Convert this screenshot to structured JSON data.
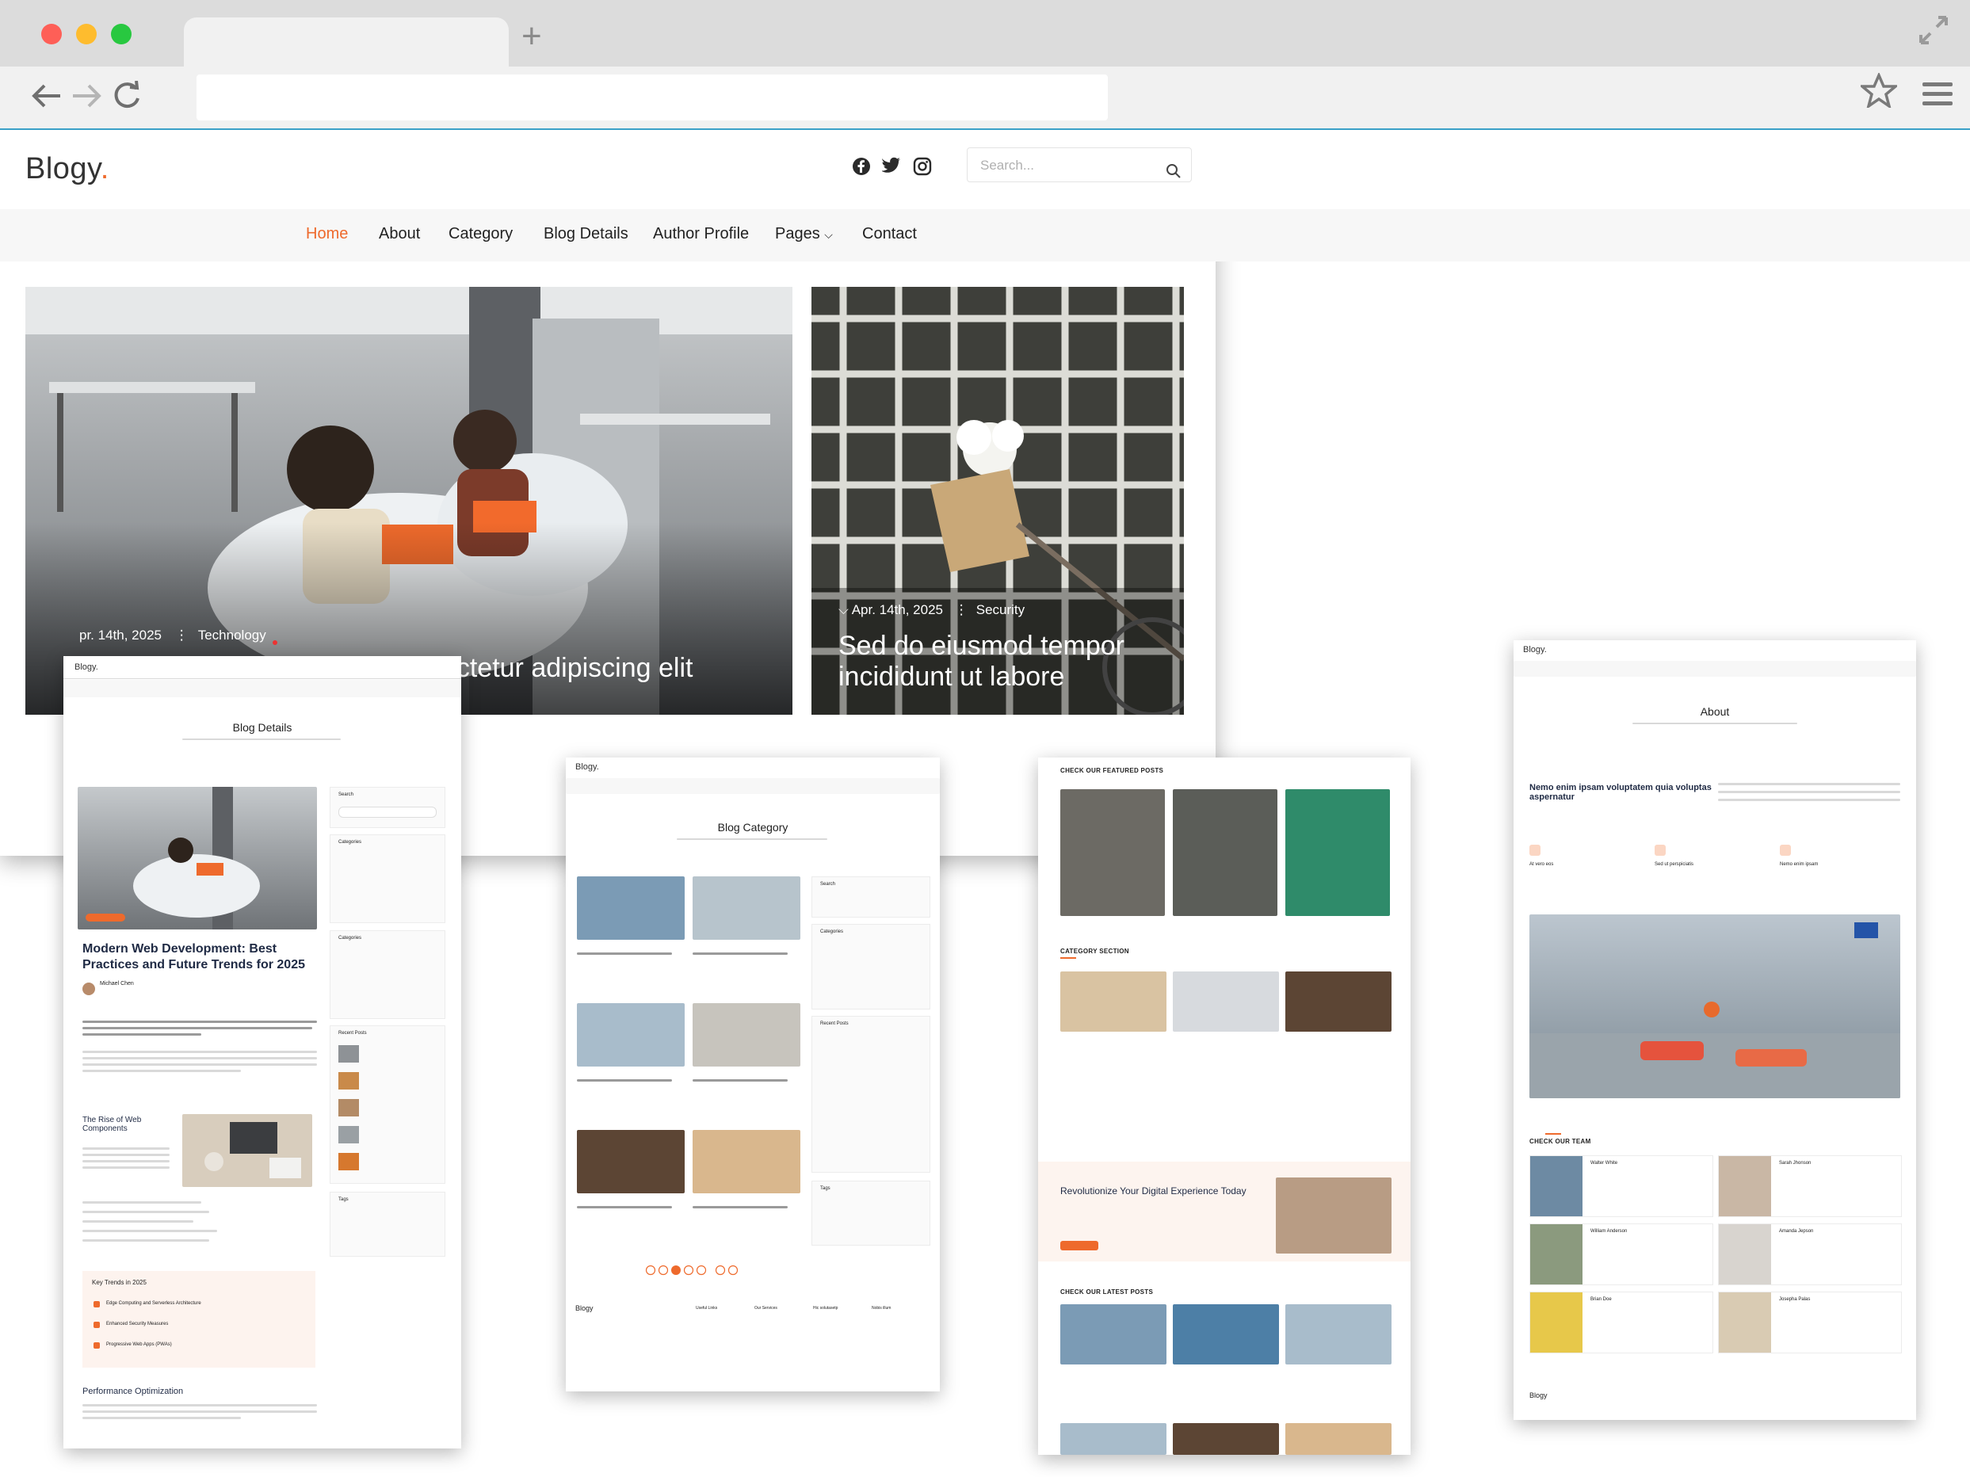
{
  "colors": {
    "accent": "#ee6a2c",
    "traffic_red": "#fe5f57",
    "traffic_yellow": "#febc2e",
    "traffic_green": "#28c840"
  },
  "browser": {
    "new_tab": "+"
  },
  "site": {
    "logo": "Blogy",
    "logo_dot": ".",
    "social_icons": [
      "facebook-icon",
      "twitter-icon",
      "instagram-icon"
    ],
    "search_placeholder": "Search...",
    "nav": [
      {
        "label": "Home",
        "active": true
      },
      {
        "label": "About"
      },
      {
        "label": "Category"
      },
      {
        "label": "Blog Details"
      },
      {
        "label": "Author Profile"
      },
      {
        "label": "Pages"
      },
      {
        "label": "Contact"
      }
    ],
    "pages_caret": "⌵"
  },
  "hero": {
    "main": {
      "date": "pr. 14th, 2025",
      "category": "Technology",
      "title": "rem ipsum dolor sit amet, consectetur adipiscing elit"
    },
    "side": {
      "date": "Apr. 14th, 2025",
      "category": "Security",
      "title": "Sed do eiusmod tempor incididunt ut labore"
    }
  },
  "blog_details": {
    "logo": "Blogy.",
    "title": "Blog Details",
    "post_title": "Modern Web Development: Best Practices and Future Trends for 2025",
    "author": "Michael Chen",
    "sub_heading": "The Rise of Web Components",
    "key_trends": "Key Trends in 2025",
    "trend_items": [
      "Edge Computing and Serverless Architecture",
      "Enhanced Security Measures",
      "Progressive Web Apps (PWAs)"
    ],
    "perf": "Performance Optimization",
    "widgets": [
      "Search",
      "Categories",
      "Categories",
      "Recent Posts",
      "Tags"
    ]
  },
  "blog_category": {
    "logo": "Blogy.",
    "title": "Blog Category",
    "widgets": [
      "Search",
      "Categories",
      "Recent Posts",
      "Tags"
    ],
    "footer_logo": "Blogy",
    "footer_cols": [
      "Useful Links",
      "Our Services",
      "Hic solutasetp",
      "Nobis illum"
    ]
  },
  "home_sections": {
    "featured": "CHECK OUR FEATURED POSTS",
    "category": "CATEGORY SECTION",
    "cta_title": "Revolutionize Your Digital Experience Today",
    "latest": "CHECK OUR LATEST POSTS"
  },
  "about": {
    "logo": "Blogy.",
    "title": "About",
    "headline": "Nemo enim ipsam voluptatem quia voluptas aspernatur",
    "features": [
      "At vero eos",
      "Sed ut perspiciatis",
      "Nemo enim ipsam"
    ],
    "team_heading": "CHECK OUR TEAM",
    "team": [
      {
        "name": "Walter White"
      },
      {
        "name": "Sarah Jhonson"
      },
      {
        "name": "William Anderson"
      },
      {
        "name": "Amanda Jepson"
      },
      {
        "name": "Brian Doe"
      },
      {
        "name": "Josepha Palas"
      }
    ],
    "footer_logo": "Blogy"
  }
}
